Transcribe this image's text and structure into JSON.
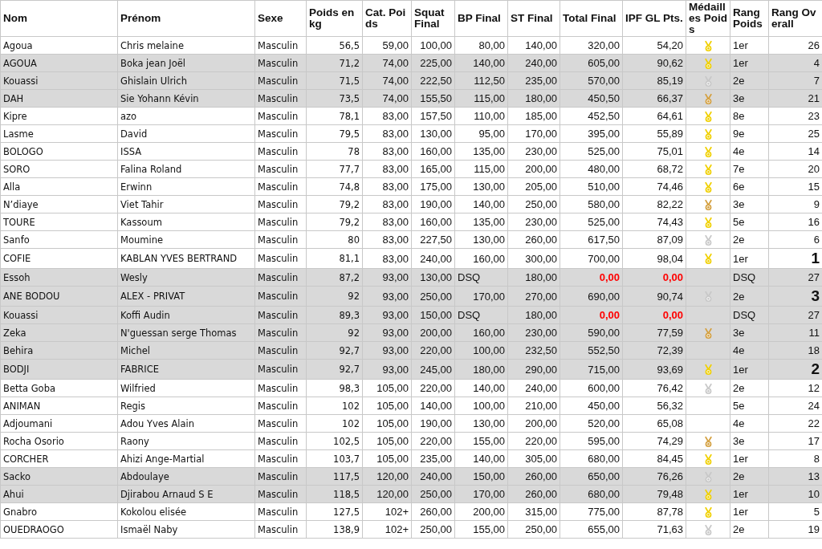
{
  "table": {
    "columns": [
      "Nom",
      "Prénom",
      "Sexe",
      "Poids en kg",
      "Cat. Poids",
      "Squat Final",
      "BP Final",
      "ST Final",
      "Total Final",
      "IPF GL Pts.",
      "Médailles Poids",
      "Rang Poids",
      "Rang Overall"
    ],
    "rows": [
      {
        "nom": "Agoua",
        "prenom": "Chris melaine",
        "sexe": "Masculin",
        "poids": "56,5",
        "cat": "59,00",
        "squat": "100,00",
        "bp": "80,00",
        "st": "140,00",
        "total": "320,00",
        "ipf": "54,20",
        "color": "#f0d000",
        "rang_poids": "1er",
        "rang_overall": "26",
        "shaded": false,
        "disqualified": false,
        "top_overall": false
      },
      {
        "nom": "AGOUA",
        "prenom": "Boka jean Joël",
        "sexe": "Masculin",
        "poids": "71,2",
        "cat": "74,00",
        "squat": "225,00",
        "bp": "140,00",
        "st": "240,00",
        "total": "605,00",
        "ipf": "90,62",
        "color": "#f0d000",
        "rang_poids": "1er",
        "rang_overall": "4",
        "shaded": true,
        "disqualified": false,
        "top_overall": false
      },
      {
        "nom": "Kouassi",
        "prenom": "Ghislain Ulrich",
        "sexe": "Masculin",
        "poids": "71,5",
        "cat": "74,00",
        "squat": "222,50",
        "bp": "112,50",
        "st": "235,00",
        "total": "570,00",
        "ipf": "85,19",
        "color": "#c8c8c8",
        "rang_poids": "2e",
        "rang_overall": "7",
        "shaded": true,
        "disqualified": false,
        "top_overall": false
      },
      {
        "nom": "DAH",
        "prenom": "Sie Yohann Kévin",
        "sexe": "Masculin",
        "poids": "73,5",
        "cat": "74,00",
        "squat": "155,50",
        "bp": "115,00",
        "st": "180,00",
        "total": "450,50",
        "ipf": "66,37",
        "color": "#d4a040",
        "rang_poids": "3e",
        "rang_overall": "21",
        "shaded": true,
        "disqualified": false,
        "top_overall": false
      },
      {
        "nom": "Kipre",
        "prenom": "azo",
        "sexe": "Masculin",
        "poids": "78,1",
        "cat": "83,00",
        "squat": "157,50",
        "bp": "110,00",
        "st": "185,00",
        "total": "452,50",
        "ipf": "64,61",
        "color": "#f0d000",
        "rang_poids": "8e",
        "rang_overall": "23",
        "shaded": false,
        "disqualified": false,
        "top_overall": false
      },
      {
        "nom": "Lasme",
        "prenom": "David",
        "sexe": "Masculin",
        "poids": "79,5",
        "cat": "83,00",
        "squat": "130,00",
        "bp": "95,00",
        "st": "170,00",
        "total": "395,00",
        "ipf": "55,89",
        "color": "#f0d000",
        "rang_poids": "9e",
        "rang_overall": "25",
        "shaded": false,
        "disqualified": false,
        "top_overall": false
      },
      {
        "nom": "BOLOGO",
        "prenom": "ISSA",
        "sexe": "Masculin",
        "poids": "78",
        "cat": "83,00",
        "squat": "160,00",
        "bp": "135,00",
        "st": "230,00",
        "total": "525,00",
        "ipf": "75,01",
        "color": "#f0d000",
        "rang_poids": "4e",
        "rang_overall": "14",
        "shaded": false,
        "disqualified": false,
        "top_overall": false
      },
      {
        "nom": "SORO",
        "prenom": "Falina Roland",
        "sexe": "Masculin",
        "poids": "77,7",
        "cat": "83,00",
        "squat": "165,00",
        "bp": "115,00",
        "st": "200,00",
        "total": "480,00",
        "ipf": "68,72",
        "color": "#f0d000",
        "rang_poids": "7e",
        "rang_overall": "20",
        "shaded": false,
        "disqualified": false,
        "top_overall": false
      },
      {
        "nom": "Alla",
        "prenom": "Erwinn",
        "sexe": "Masculin",
        "poids": "74,8",
        "cat": "83,00",
        "squat": "175,00",
        "bp": "130,00",
        "st": "205,00",
        "total": "510,00",
        "ipf": "74,46",
        "color": "#f0d000",
        "rang_poids": "6e",
        "rang_overall": "15",
        "shaded": false,
        "disqualified": false,
        "top_overall": false
      },
      {
        "nom": "N’diaye",
        "prenom": "Viet Tahir",
        "sexe": "Masculin",
        "poids": "79,2",
        "cat": "83,00",
        "squat": "190,00",
        "bp": "140,00",
        "st": "250,00",
        "total": "580,00",
        "ipf": "82,22",
        "color": "#d4a040",
        "rang_poids": "3e",
        "rang_overall": "9",
        "shaded": false,
        "disqualified": false,
        "top_overall": false
      },
      {
        "nom": "TOURE",
        "prenom": "Kassoum",
        "sexe": "Masculin",
        "poids": "79,2",
        "cat": "83,00",
        "squat": "160,00",
        "bp": "135,00",
        "st": "230,00",
        "total": "525,00",
        "ipf": "74,43",
        "color": "#f0d000",
        "rang_poids": "5e",
        "rang_overall": "16",
        "shaded": false,
        "disqualified": false,
        "top_overall": false
      },
      {
        "nom": "Sanfo",
        "prenom": "Moumine",
        "sexe": "Masculin",
        "poids": "80",
        "cat": "83,00",
        "squat": "227,50",
        "bp": "130,00",
        "st": "260,00",
        "total": "617,50",
        "ipf": "87,09",
        "color": "#c8c8c8",
        "rang_poids": "2e",
        "rang_overall": "6",
        "shaded": false,
        "disqualified": false,
        "top_overall": false
      },
      {
        "nom": "COFIE",
        "prenom": "KABLAN YVES BERTRAND",
        "sexe": "Masculin",
        "poids": "81,1",
        "cat": "83,00",
        "squat": "240,00",
        "bp": "160,00",
        "st": "300,00",
        "total": "700,00",
        "ipf": "98,04",
        "color": "#f0d000",
        "rang_poids": "1er",
        "rang_overall": "1",
        "shaded": false,
        "disqualified": false,
        "top_overall": true
      },
      {
        "nom": "Essoh",
        "prenom": "Wesly",
        "sexe": "Masculin",
        "poids": "87,2",
        "cat": "93,00",
        "squat": "130,00",
        "bp": "DSQ",
        "st": "180,00",
        "total": "0,00",
        "ipf": "0,00",
        "rang_poids": "DSQ",
        "rang_overall": "27",
        "shaded": true,
        "disqualified": true,
        "top_overall": false
      },
      {
        "nom": "ANE BODOU",
        "prenom": "ALEX - PRIVAT",
        "sexe": "Masculin",
        "poids": "92",
        "cat": "93,00",
        "squat": "250,00",
        "bp": "170,00",
        "st": "270,00",
        "total": "690,00",
        "ipf": "90,74",
        "color": "#c8c8c8",
        "rang_poids": "2e",
        "rang_overall": "3",
        "shaded": true,
        "disqualified": false,
        "top_overall": true
      },
      {
        "nom": "Kouassi",
        "prenom": "Koffi Audin",
        "sexe": "Masculin",
        "poids": "89,3",
        "cat": "93,00",
        "squat": "150,00",
        "bp": "DSQ",
        "st": "180,00",
        "total": "0,00",
        "ipf": "0,00",
        "rang_poids": "DSQ",
        "rang_overall": "27",
        "shaded": true,
        "disqualified": true,
        "top_overall": false
      },
      {
        "nom": "Zeka",
        "prenom": "N'guessan serge Thomas",
        "sexe": "Masculin",
        "poids": "92",
        "cat": "93,00",
        "squat": "200,00",
        "bp": "160,00",
        "st": "230,00",
        "total": "590,00",
        "ipf": "77,59",
        "color": "#d4a040",
        "rang_poids": "3e",
        "rang_overall": "11",
        "shaded": true,
        "disqualified": false,
        "top_overall": false
      },
      {
        "nom": "Behira",
        "prenom": "Michel",
        "sexe": "Masculin",
        "poids": "92,7",
        "cat": "93,00",
        "squat": "220,00",
        "bp": "100,00",
        "st": "232,50",
        "total": "552,50",
        "ipf": "72,39",
        "rang_poids": "4e",
        "rang_overall": "18",
        "shaded": true,
        "disqualified": false,
        "top_overall": false
      },
      {
        "nom": "BODJI",
        "prenom": "FABRICE",
        "sexe": "Masculin",
        "poids": "92,7",
        "cat": "93,00",
        "squat": "245,00",
        "bp": "180,00",
        "st": "290,00",
        "total": "715,00",
        "ipf": "93,69",
        "color": "#f0d000",
        "rang_poids": "1er",
        "rang_overall": "2",
        "shaded": true,
        "disqualified": false,
        "top_overall": true
      },
      {
        "nom": "Betta Goba",
        "prenom": "Wilfried",
        "sexe": "Masculin",
        "poids": "98,3",
        "cat": "105,00",
        "squat": "220,00",
        "bp": "140,00",
        "st": "240,00",
        "total": "600,00",
        "ipf": "76,42",
        "color": "#c8c8c8",
        "rang_poids": "2e",
        "rang_overall": "12",
        "shaded": false,
        "disqualified": false,
        "top_overall": false
      },
      {
        "nom": "ANIMAN",
        "prenom": "Regis",
        "sexe": "Masculin",
        "poids": "102",
        "cat": "105,00",
        "squat": "140,00",
        "bp": "100,00",
        "st": "210,00",
        "total": "450,00",
        "ipf": "56,32",
        "rang_poids": "5e",
        "rang_overall": "24",
        "shaded": false,
        "disqualified": false,
        "top_overall": false
      },
      {
        "nom": "Adjoumani",
        "prenom": "Adou Yves Alain",
        "sexe": "Masculin",
        "poids": "102",
        "cat": "105,00",
        "squat": "190,00",
        "bp": "130,00",
        "st": "200,00",
        "total": "520,00",
        "ipf": "65,08",
        "rang_poids": "4e",
        "rang_overall": "22",
        "shaded": false,
        "disqualified": false,
        "top_overall": false
      },
      {
        "nom": "Rocha Osorio",
        "prenom": "Raony",
        "sexe": "Masculin",
        "poids": "102,5",
        "cat": "105,00",
        "squat": "220,00",
        "bp": "155,00",
        "st": "220,00",
        "total": "595,00",
        "ipf": "74,29",
        "color": "#d4a040",
        "rang_poids": "3e",
        "rang_overall": "17",
        "shaded": false,
        "disqualified": false,
        "top_overall": false
      },
      {
        "nom": "CORCHER",
        "prenom": "Ahizi Ange-Martial",
        "sexe": "Masculin",
        "poids": "103,7",
        "cat": "105,00",
        "squat": "235,00",
        "bp": "140,00",
        "st": "305,00",
        "total": "680,00",
        "ipf": "84,45",
        "color": "#f0d000",
        "rang_poids": "1er",
        "rang_overall": "8",
        "shaded": false,
        "disqualified": false,
        "top_overall": false
      },
      {
        "nom": "Sacko",
        "prenom": "Abdoulaye",
        "sexe": "Masculin",
        "poids": "117,5",
        "cat": "120,00",
        "squat": "240,00",
        "bp": "150,00",
        "st": "260,00",
        "total": "650,00",
        "ipf": "76,26",
        "color": "#c8c8c8",
        "rang_poids": "2e",
        "rang_overall": "13",
        "shaded": true,
        "disqualified": false,
        "top_overall": false
      },
      {
        "nom": "Ahui",
        "prenom": "Djirabou Arnaud S E",
        "sexe": "Masculin",
        "poids": "118,5",
        "cat": "120,00",
        "squat": "250,00",
        "bp": "170,00",
        "st": "260,00",
        "total": "680,00",
        "ipf": "79,48",
        "color": "#f0d000",
        "rang_poids": "1er",
        "rang_overall": "10",
        "shaded": true,
        "disqualified": false,
        "top_overall": false
      },
      {
        "nom": "Gnabro",
        "prenom": "Kokolou elisée",
        "sexe": "Masculin",
        "poids": "127,5",
        "cat": "102+",
        "squat": "260,00",
        "bp": "200,00",
        "st": "315,00",
        "total": "775,00",
        "ipf": "87,78",
        "color": "#f0d000",
        "rang_poids": "1er",
        "rang_overall": "5",
        "shaded": false,
        "disqualified": false,
        "top_overall": false
      },
      {
        "nom": "OUEDRAOGO",
        "prenom": "Ismaël Naby",
        "sexe": "Masculin",
        "poids": "138,9",
        "cat": "102+",
        "squat": "250,00",
        "bp": "155,00",
        "st": "250,00",
        "total": "655,00",
        "ipf": "71,63",
        "color": "#c8c8c8",
        "rang_poids": "2e",
        "rang_overall": "19",
        "shaded": false,
        "disqualified": false,
        "top_overall": false
      }
    ]
  }
}
